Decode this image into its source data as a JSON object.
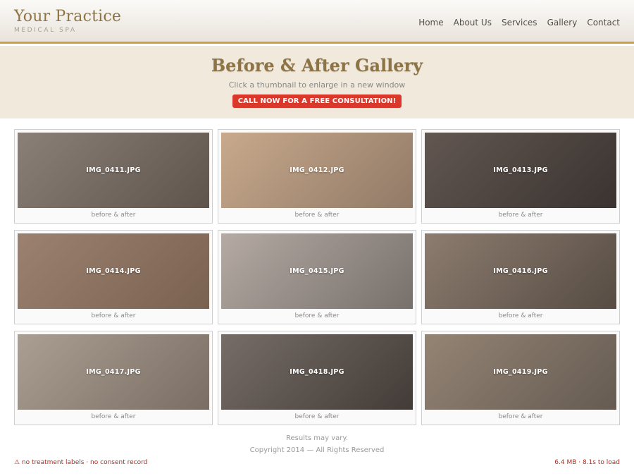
{
  "brand": {
    "title": "Your Practice",
    "subtitle": "MEDICAL SPA"
  },
  "nav": [
    "Home",
    "About Us",
    "Services",
    "Gallery",
    "Contact"
  ],
  "hero": {
    "title": "Before & After Gallery",
    "subtitle": "Click a thumbnail to enlarge in a new window",
    "cta": "CALL NOW FOR A FREE CONSULTATION!"
  },
  "gallery": [
    {
      "filename": "IMG_0411.JPG",
      "caption": "before & after",
      "colors": [
        "#8a8078",
        "#5e544c"
      ]
    },
    {
      "filename": "IMG_0412.JPG",
      "caption": "before & after",
      "colors": [
        "#c8a98c",
        "#917a67"
      ]
    },
    {
      "filename": "IMG_0413.JPG",
      "caption": "before & after",
      "colors": [
        "#625751",
        "#3a3330"
      ]
    },
    {
      "filename": "IMG_0414.JPG",
      "caption": "before & after",
      "colors": [
        "#9c8170",
        "#7a6250"
      ]
    },
    {
      "filename": "IMG_0415.JPG",
      "caption": "before & after",
      "colors": [
        "#b5aaa4",
        "#77706b"
      ]
    },
    {
      "filename": "IMG_0416.JPG",
      "caption": "before & after",
      "colors": [
        "#8d7c6f",
        "#564c43"
      ]
    },
    {
      "filename": "IMG_0417.JPG",
      "caption": "before & after",
      "colors": [
        "#ab9f93",
        "#7a6e64"
      ]
    },
    {
      "filename": "IMG_0418.JPG",
      "caption": "before & after",
      "colors": [
        "#766d67",
        "#433b37"
      ]
    },
    {
      "filename": "IMG_0419.JPG",
      "caption": "before & after",
      "colors": [
        "#948474",
        "#655b52"
      ]
    }
  ],
  "footer": {
    "note": "Results may vary.",
    "copyright": "Copyright 2014 — All Rights Reserved"
  },
  "status": {
    "warning": "⚠ no treatment labels · no consent record",
    "load": "6.4 MB · 8.1s to load"
  },
  "colors": {
    "accent": "#8e7444",
    "rule": "#c9a23c",
    "cta": "#d9382b",
    "hero_bg": "#f1e9dc",
    "status": "#b02a1e"
  }
}
